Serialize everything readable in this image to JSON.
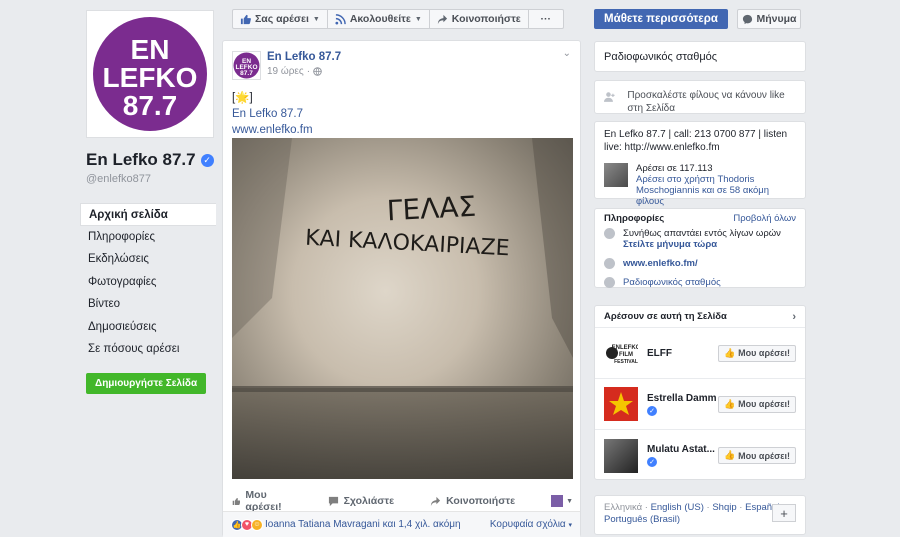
{
  "left": {
    "page_name": "En Lefko 87.7",
    "handle": "@enlefko877",
    "logo_lines": [
      "EN",
      "LEFKO",
      "87.7"
    ],
    "nav": [
      {
        "label": "Αρχική σελίδα",
        "active": true
      },
      {
        "label": "Πληροφορίες"
      },
      {
        "label": "Εκδηλώσεις"
      },
      {
        "label": "Φωτογραφίες"
      },
      {
        "label": "Βίντεο"
      },
      {
        "label": "Δημοσιεύσεις"
      },
      {
        "label": "Σε πόσους αρέσει"
      }
    ],
    "create_label": "Δημιουργήστε Σελίδα"
  },
  "actionbar": {
    "like_label": "Σας αρέσει",
    "follow_label": "Ακολουθείτε",
    "share_label": "Κοινοποιήστε",
    "more_label": "···"
  },
  "header_buttons": {
    "learn_more": "Μάθετε περισσότερα",
    "message": "Μήνυμα"
  },
  "post": {
    "author": "En Lefko 87.7",
    "time": "19 ώρες",
    "separator": "·",
    "line1": "[🌟]",
    "line2": "En Lefko 87.7",
    "line3": "www.enlefko.fm",
    "graffiti_line1": "ΓΕΛΑΣ",
    "graffiti_line2": "ΚΑΙ ΚΑΛΟΚΑΙΡΙΑΖΕ",
    "actions": {
      "like": "Μου αρέσει!",
      "comment": "Σχολιάστε",
      "share": "Κοινοποιήστε"
    },
    "reactions_text": "Ioanna Tatiana Mavragani και 1,4 χιλ. ακόμη",
    "top_comments": "Κορυφαία σχόλια",
    "top_comments_caret": "▾"
  },
  "right": {
    "category_title": "Ραδιοφωνικός σταθμός",
    "invite_text": "Προσκαλέστε φίλους να κάνουν like στη Σελίδα",
    "about_text": "En Lefko 87.7 | call: 213 0700 877 | listen live: http://www.enlefko.fm",
    "likes_count": "Αρέσει σε 117.113",
    "likes_friend_text": "Αρέσει στο χρήστη Thodoris Moschogiannis και σε 58 ακόμη φίλους",
    "info_title": "Πληροφορίες",
    "see_all": "Προβολή όλων",
    "response_text": "Συνήθως απαντάει εντός λίγων ωρών",
    "send_message": "Στείλτε μήνυμα τώρα",
    "website": "www.enlefko.fm/",
    "category_link": "Ραδιοφωνικός σταθμός",
    "likes_section_title": "Αρέσουν σε αυτή τη Σελίδα",
    "liked_pages": [
      {
        "name": "ELFF",
        "button": "Μου αρέσει!",
        "verified": false
      },
      {
        "name": "Estrella Damm",
        "button": "Μου αρέσει!",
        "verified": true
      },
      {
        "name": "Mulatu Astat...",
        "button": "Μου αρέσει!",
        "verified": true
      }
    ],
    "languages_line1": [
      "Ελληνικά",
      "English (US)",
      "Shqip",
      "Español"
    ],
    "languages_line2": [
      "Português (Brasil)"
    ],
    "lang_sep": "·",
    "plus": "+"
  },
  "colors": {
    "logo_purple": "#7b2c8f",
    "primary_blue": "#4267b2",
    "link_blue": "#365899",
    "green": "#42b72a",
    "bg": "#e9ebee"
  }
}
